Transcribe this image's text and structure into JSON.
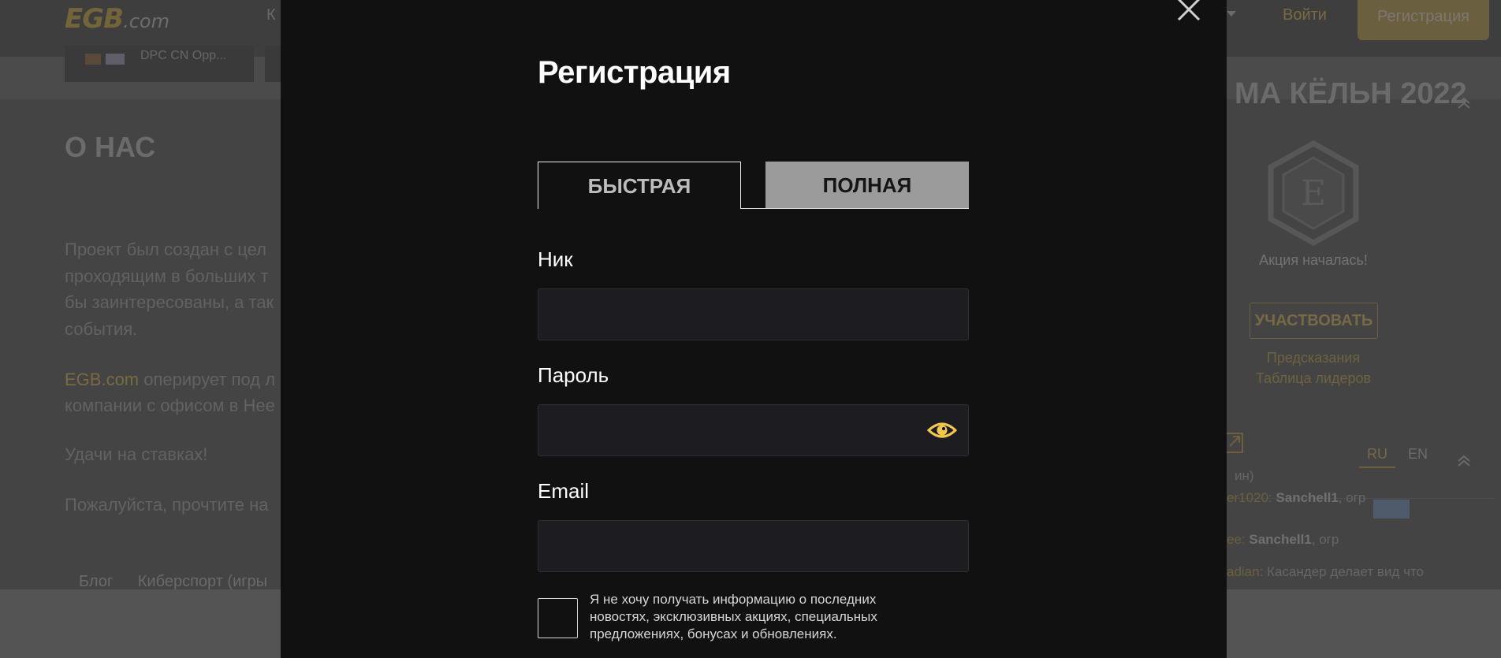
{
  "header": {
    "logo_main": "EGB",
    "logo_suffix": ".com",
    "nav_fragment": "К",
    "login_label": "Войти",
    "register_label": "Регистрация"
  },
  "ticker": {
    "match_text": "DPC CN Opp..."
  },
  "about": {
    "title": "О НАС",
    "para1": [
      "Проект был создан с цел",
      "проходящим в больших т",
      "бы заинтересованы, а так",
      "события."
    ],
    "para2_link": "EGB.com",
    "para2_rest": " оперирует под л",
    "para2_line2": "компании с офисом в Нее",
    "para3": "Удачи на ставках!",
    "para4": "Пожалуйста, прочтите на"
  },
  "footer": {
    "links": [
      "Блог",
      "Киберспорт (игры"
    ]
  },
  "sidebar": {
    "promo_title": "МА КЁЛЬН 2022",
    "promo_status": "Акция началась!",
    "participate_label": "УЧАСТВОВАТЬ",
    "link_predictions": "Предсказания",
    "link_leaderboard": "Таблица лидеров",
    "lang_ru": "RU",
    "lang_en": "EN",
    "chat_fragment": "ин)",
    "chat1_user": "er1020:",
    "chat1_text": "Sanchell1",
    "chat1_rest": ", огр",
    "chat2_user": "ee:",
    "chat2_text": "Sanchell1",
    "chat2_rest": ", огр",
    "chat3_user": "adian:",
    "chat3_text": "Касандер делает вид что"
  },
  "modal": {
    "title": "Регистрация",
    "tab_fast": "БЫСТРАЯ",
    "tab_full": "ПОЛНАЯ",
    "nick_label": "Ник",
    "nick_value": "",
    "password_label": "Пароль",
    "password_value": "",
    "email_label": "Email",
    "email_value": "",
    "newsletter_optout": "Я не хочу получать информацию о последних новостях, эксклюзивных акциях, специальных предложениях, бонусах и обновлениях.",
    "accent_color": "#f2c94c"
  }
}
